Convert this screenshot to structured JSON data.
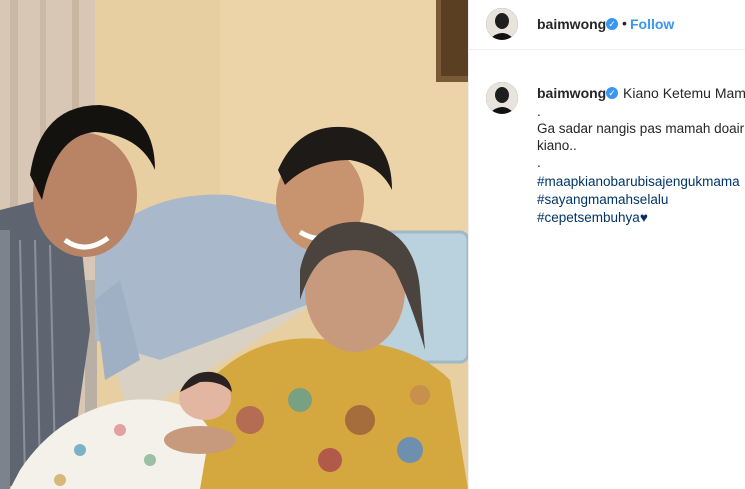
{
  "post": {
    "username": "baimwong",
    "verified_icon": "verified-badge-icon",
    "separator": "•",
    "follow_label": "Follow",
    "caption": {
      "first_line": "Kiano Ketemu Mam",
      "lines": [
        ".",
        "Ga sadar nangis pas mamah doair",
        "kiano..",
        "."
      ],
      "hashtags": [
        "#maapkianobarubisajengukmama",
        "#sayangmamahselalu",
        "#cepetsembuhya"
      ],
      "heart_emoji": "♥"
    }
  },
  "colors": {
    "accent": "#3897f0",
    "hashtag": "#003569",
    "text": "#262626",
    "border": "#efefef"
  }
}
